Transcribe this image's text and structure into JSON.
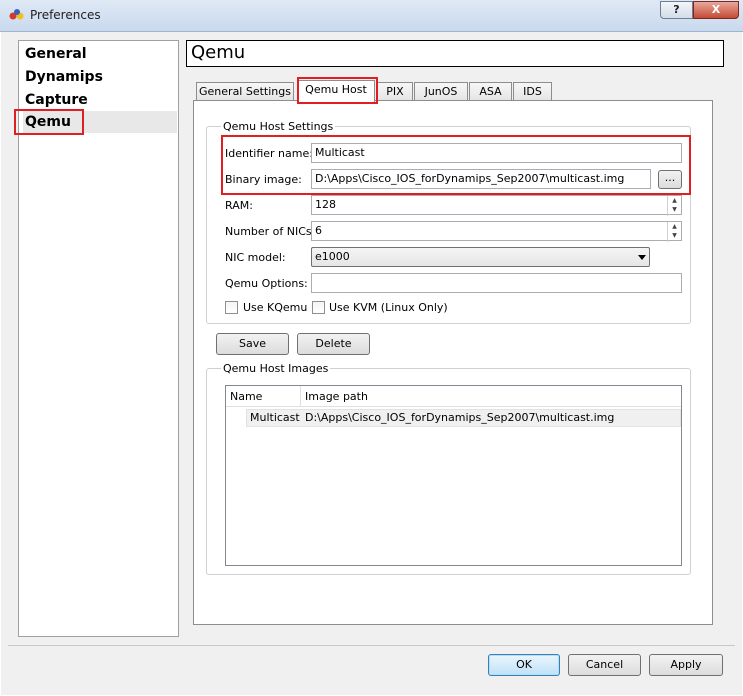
{
  "window": {
    "title": "Preferences",
    "help_label": "?",
    "close_label": "X"
  },
  "sidebar": {
    "items": [
      {
        "label": "General"
      },
      {
        "label": "Dynamips"
      },
      {
        "label": "Capture"
      },
      {
        "label": "Qemu"
      }
    ]
  },
  "header": {
    "title": "Qemu"
  },
  "tabs": [
    {
      "label": "General Settings"
    },
    {
      "label": "Qemu Host"
    },
    {
      "label": "PIX"
    },
    {
      "label": "JunOS"
    },
    {
      "label": "ASA"
    },
    {
      "label": "IDS"
    }
  ],
  "host_settings": {
    "group_title": "Qemu Host Settings",
    "identifier_label": "Identifier name:",
    "identifier_value": "Multicast",
    "binary_label": "Binary image:",
    "binary_value": "D:\\Apps\\Cisco_IOS_forDynamips_Sep2007\\multicast.img",
    "browse_label": "...",
    "ram_label": "RAM:",
    "ram_value": "128",
    "nics_label": "Number of NICs:",
    "nics_value": "6",
    "nic_model_label": "NIC model:",
    "nic_model_value": "e1000",
    "options_label": "Qemu Options:",
    "options_value": "",
    "use_kqemu_label": "Use KQemu",
    "use_kvm_label": "Use KVM (Linux Only)"
  },
  "actions": {
    "save_label": "Save",
    "delete_label": "Delete"
  },
  "images": {
    "group_title": "Qemu Host Images",
    "columns": [
      "Name",
      "Image path"
    ],
    "rows": [
      {
        "name": "Multicast",
        "path": "D:\\Apps\\Cisco_IOS_forDynamips_Sep2007\\multicast.img"
      }
    ]
  },
  "dialog_buttons": {
    "ok_label": "OK",
    "cancel_label": "Cancel",
    "apply_label": "Apply"
  }
}
